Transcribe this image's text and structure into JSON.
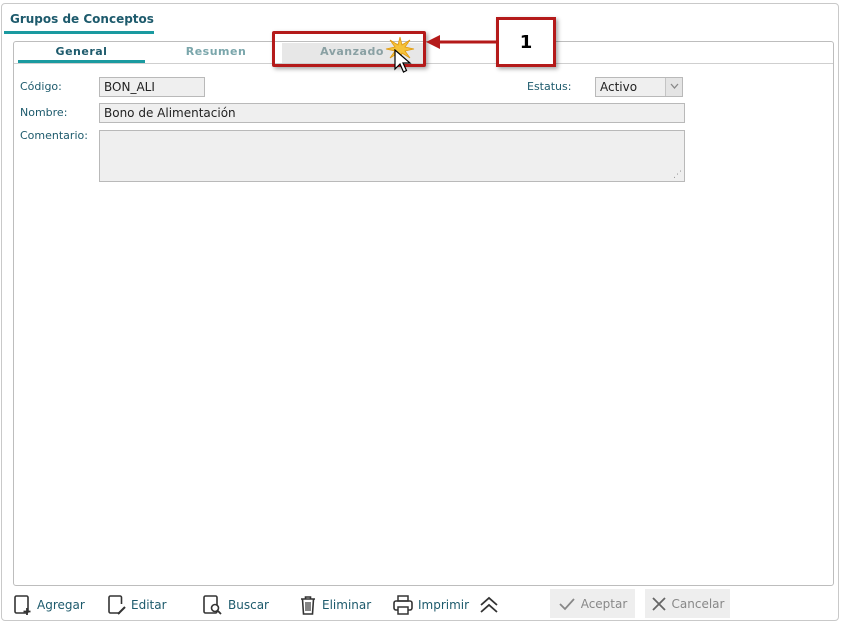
{
  "window": {
    "title": "Grupos de Conceptos"
  },
  "tabs": [
    {
      "label": "General",
      "active": true
    },
    {
      "label": "Resumen",
      "active": false
    },
    {
      "label": "Avanzado",
      "active": false
    }
  ],
  "form": {
    "codigo_label": "Código:",
    "codigo_value": "BON_ALI",
    "estatus_label": "Estatus:",
    "estatus_value": "Activo",
    "nombre_label": "Nombre:",
    "nombre_value": "Bono de Alimentación",
    "comentario_label": "Comentario:",
    "comentario_value": ""
  },
  "toolbar": {
    "agregar": "Agregar",
    "editar": "Editar",
    "buscar": "Buscar",
    "eliminar": "Eliminar",
    "imprimir": "Imprimir",
    "aceptar": "Aceptar",
    "cancelar": "Cancelar"
  },
  "annotation": {
    "number": "1"
  },
  "colors": {
    "accent": "#1a9aa0",
    "text_primary": "#1d5a6c",
    "callout": "#b41a1a"
  },
  "icons": [
    "add-document-icon",
    "edit-document-icon",
    "search-document-icon",
    "trash-icon",
    "printer-icon",
    "double-chevron-up-icon",
    "check-icon",
    "close-icon",
    "chevron-down-icon",
    "cursor-icon"
  ]
}
